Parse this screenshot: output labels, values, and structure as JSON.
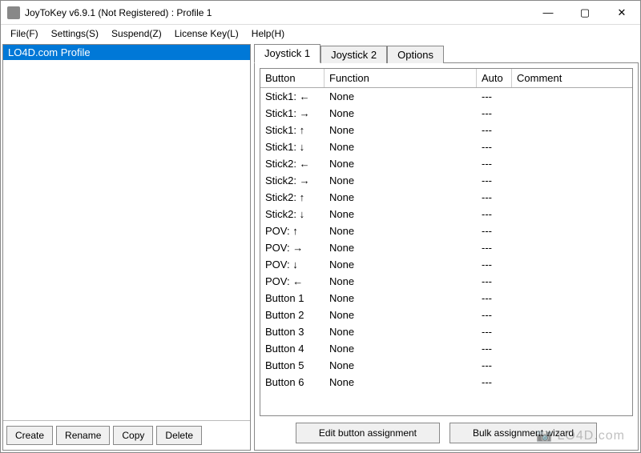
{
  "window": {
    "title": "JoyToKey v6.9.1 (Not Registered) : Profile 1"
  },
  "menu": {
    "file": "File(F)",
    "settings": "Settings(S)",
    "suspend": "Suspend(Z)",
    "license": "License Key(L)",
    "help": "Help(H)"
  },
  "profiles": {
    "items": [
      {
        "label": "LO4D.com Profile",
        "selected": true
      }
    ]
  },
  "profileButtons": {
    "create": "Create",
    "rename": "Rename",
    "copy": "Copy",
    "delete": "Delete"
  },
  "tabs": {
    "joystick1": "Joystick 1",
    "joystick2": "Joystick 2",
    "options": "Options",
    "active": "joystick1"
  },
  "table": {
    "headers": {
      "button": "Button",
      "function": "Function",
      "auto": "Auto",
      "comment": "Comment"
    },
    "rows": [
      {
        "button": "Stick1: ←",
        "function": "None",
        "auto": "---",
        "comment": ""
      },
      {
        "button": "Stick1: →",
        "function": "None",
        "auto": "---",
        "comment": ""
      },
      {
        "button": "Stick1: ↑",
        "function": "None",
        "auto": "---",
        "comment": ""
      },
      {
        "button": "Stick1: ↓",
        "function": "None",
        "auto": "---",
        "comment": ""
      },
      {
        "button": "Stick2: ←",
        "function": "None",
        "auto": "---",
        "comment": ""
      },
      {
        "button": "Stick2: →",
        "function": "None",
        "auto": "---",
        "comment": ""
      },
      {
        "button": "Stick2: ↑",
        "function": "None",
        "auto": "---",
        "comment": ""
      },
      {
        "button": "Stick2: ↓",
        "function": "None",
        "auto": "---",
        "comment": ""
      },
      {
        "button": "POV: ↑",
        "function": "None",
        "auto": "---",
        "comment": ""
      },
      {
        "button": "POV: →",
        "function": "None",
        "auto": "---",
        "comment": ""
      },
      {
        "button": "POV: ↓",
        "function": "None",
        "auto": "---",
        "comment": ""
      },
      {
        "button": "POV: ←",
        "function": "None",
        "auto": "---",
        "comment": ""
      },
      {
        "button": "Button 1",
        "function": "None",
        "auto": "---",
        "comment": ""
      },
      {
        "button": "Button 2",
        "function": "None",
        "auto": "---",
        "comment": ""
      },
      {
        "button": "Button 3",
        "function": "None",
        "auto": "---",
        "comment": ""
      },
      {
        "button": "Button 4",
        "function": "None",
        "auto": "---",
        "comment": ""
      },
      {
        "button": "Button 5",
        "function": "None",
        "auto": "---",
        "comment": ""
      },
      {
        "button": "Button 6",
        "function": "None",
        "auto": "---",
        "comment": ""
      }
    ]
  },
  "bottomButtons": {
    "edit": "Edit button assignment",
    "bulk": "Bulk assignment wizard"
  },
  "watermark": "📷 LO4D.com"
}
